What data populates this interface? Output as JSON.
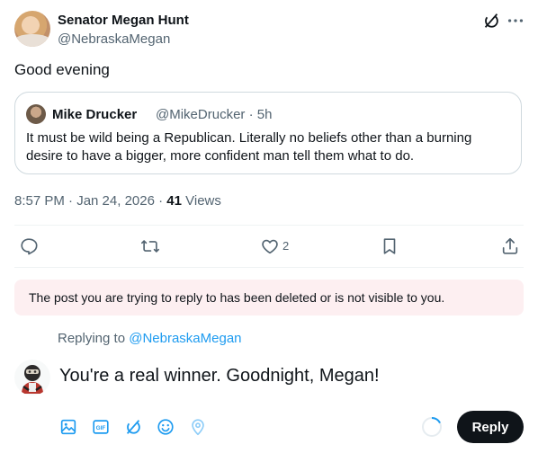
{
  "author": {
    "display_name": "Senator Megan Hunt",
    "handle": "@NebraskaMegan"
  },
  "post": {
    "text": "Good evening",
    "time": "8:57 PM · Jan 24, 2026",
    "separator": "·",
    "views_count": "41",
    "views_label": "Views"
  },
  "quote": {
    "display_name": "Mike Drucker",
    "handle_time": "@MikeDrucker · 5h",
    "text": "It must be wild being a Republican. Literally no beliefs other than a burning desire to have a bigger, more confident man tell them what to do."
  },
  "actions": {
    "like_count": "2"
  },
  "notice": {
    "text": "The post you are trying to reply to has been deleted or is not visible to you."
  },
  "reply": {
    "replying_prefix": "Replying to",
    "replying_to": "@NebraskaMegan",
    "draft_text": "You're a real winner.  Goodnight, Megan!",
    "button_label": "Reply",
    "gif_label": "GIF"
  },
  "colors": {
    "accent": "#1d9bf0",
    "text": "#0f1419",
    "secondary": "#536471",
    "notice_bg": "#fdeff1"
  },
  "icons": [
    "grok-icon",
    "more-icon",
    "reply-icon",
    "repost-icon",
    "like-icon",
    "bookmark-icon",
    "share-icon",
    "image-icon",
    "gif-icon",
    "grok-icon",
    "emoji-icon",
    "location-icon",
    "spinner-icon"
  ]
}
